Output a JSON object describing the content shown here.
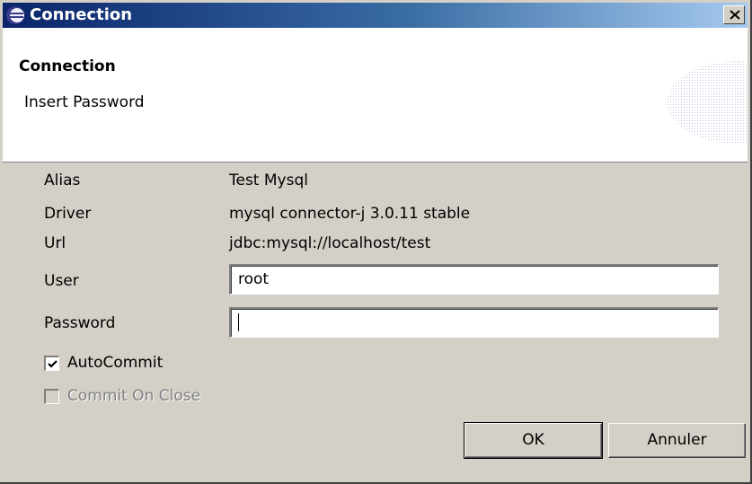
{
  "window": {
    "title": "Connection",
    "icon": "eclipse-icon",
    "close_label": "×"
  },
  "banner": {
    "title": "Connection",
    "message": "Insert Password"
  },
  "form": {
    "alias": {
      "label": "Alias",
      "value": "Test Mysql"
    },
    "driver": {
      "label": "Driver",
      "value": "mysql connector-j 3.0.11 stable"
    },
    "url": {
      "label": "Url",
      "value": "jdbc:mysql://localhost/test"
    },
    "user": {
      "label": "User",
      "value": "root"
    },
    "password": {
      "label": "Password",
      "value": ""
    },
    "autocommit": {
      "label": "AutoCommit",
      "checked": true,
      "enabled": true
    },
    "commit_on_close": {
      "label": "Commit On Close",
      "checked": false,
      "enabled": false
    }
  },
  "buttons": {
    "ok": "OK",
    "cancel": "Annuler"
  },
  "colors": {
    "title_gradient_start": "#0a246a",
    "title_gradient_end": "#a6caf0",
    "dialog_bg": "#d4d0c8"
  }
}
